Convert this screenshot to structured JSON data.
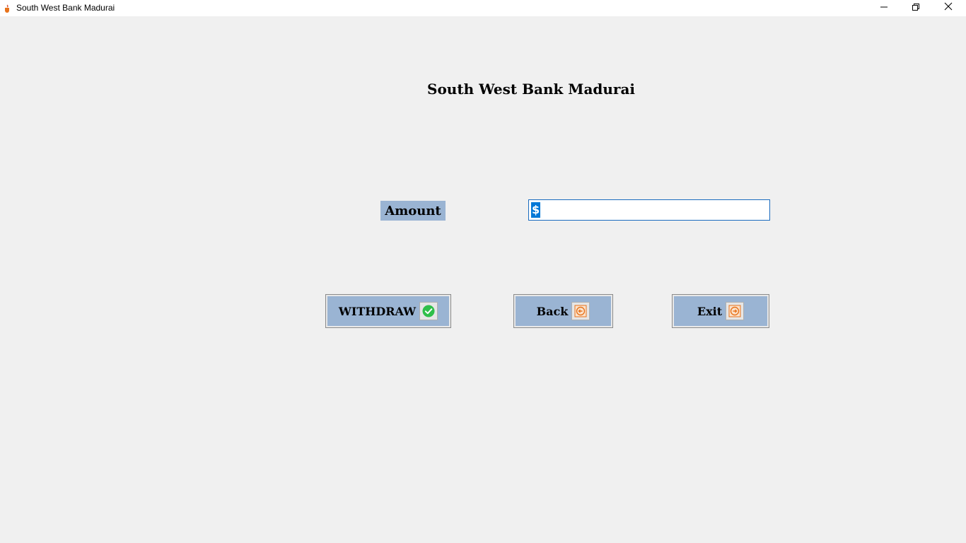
{
  "window": {
    "title": "South West Bank Madurai",
    "minimize_icon": "minimize-icon",
    "maximize_icon": "restore-icon",
    "close_icon": "close-icon"
  },
  "main": {
    "heading": "South West Bank Madurai",
    "amount_label": "Amount",
    "amount_value": "$"
  },
  "buttons": {
    "withdraw": {
      "label": "WITHDRAW",
      "icon": "check-icon"
    },
    "back": {
      "label": "Back",
      "icon": "back-arrow-icon"
    },
    "exit": {
      "label": "Exit",
      "icon": "exit-arrow-icon"
    }
  },
  "colors": {
    "button_bg": "#9ab4d3",
    "selection": "#0078d7",
    "check_green": "#2fbf4a",
    "arrow_orange": "#e8731c"
  }
}
